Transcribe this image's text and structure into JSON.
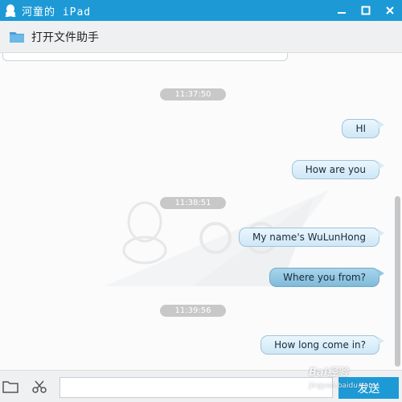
{
  "window": {
    "title": "河童的 iPad",
    "controls": [
      "minimize-icon",
      "maximize-icon",
      "close-icon"
    ]
  },
  "toolbar": {
    "open_file_assistant_label": "打开文件助手",
    "icon": "folder-icon"
  },
  "messages": [
    {
      "type": "timestamp",
      "text": "11:37:50"
    },
    {
      "type": "bubble",
      "text": "HI",
      "style": "light"
    },
    {
      "type": "bubble",
      "text": "How are you",
      "style": "light"
    },
    {
      "type": "timestamp",
      "text": "11:38:51"
    },
    {
      "type": "bubble",
      "text": "My name's WuLunHong",
      "style": "light"
    },
    {
      "type": "bubble",
      "text": "Where you from?",
      "style": "dark"
    },
    {
      "type": "timestamp",
      "text": "11:39:56"
    },
    {
      "type": "bubble",
      "text": "How long come in?",
      "style": "light"
    }
  ],
  "input": {
    "value": "",
    "placeholder": ""
  },
  "send_button_label": "发送",
  "bottom_icons": [
    "folder-icon",
    "scissors-icon"
  ],
  "site_watermark": {
    "brand": "Bai",
    "brand_cn": "经验",
    "url": "jingyan.baidu.com"
  },
  "colors": {
    "accent": "#1d9ad6",
    "bubble_light": "#cfe7f6",
    "bubble_dark": "#7fbad9",
    "timestamp_bg": "#c8c8c8"
  }
}
